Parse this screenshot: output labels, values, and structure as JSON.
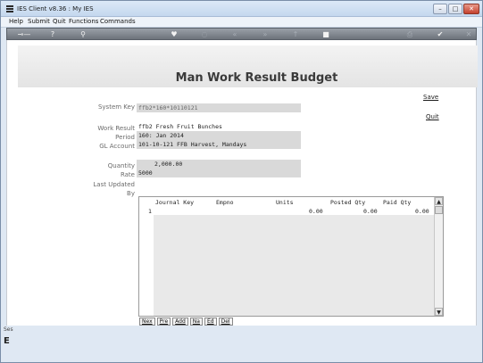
{
  "window": {
    "title": "IES Client v8.36 : My IES",
    "controls": {
      "minimize": "–",
      "maximize": "□",
      "close": "✕"
    }
  },
  "menu": {
    "items": [
      "Help",
      "Submit",
      "Quit",
      "Functions",
      "Commands"
    ]
  },
  "toolbar": {
    "icons": [
      "key-icon",
      "help-icon",
      "search-icon",
      "heart-icon",
      "refresh-icon",
      "rewind-icon",
      "forward-icon",
      "upload-icon",
      "stop-icon",
      "print-icon",
      "check-icon",
      "close-icon"
    ]
  },
  "page": {
    "title": "Man Work Result Budget",
    "save_label": "Save",
    "quit_label": "Quit"
  },
  "form": {
    "system_key_label": "System Key",
    "system_key_value": "ffb2*160*10110121",
    "work_result_label": "Work Result",
    "work_result_value": "ffb2  Fresh Fruit Bunches",
    "period_label": "Period",
    "period_value": "160: Jan 2014",
    "gl_account_label": "GL Account",
    "gl_account_value": "101-10-121 FFB Harvest, Mandays",
    "quantity_label": "Quantity",
    "quantity_value": "2,000.00",
    "rate_label": "Rate",
    "rate_value": "5000",
    "last_updated_label": "Last Updated",
    "by_label": "By"
  },
  "grid": {
    "columns": [
      "Journal Key",
      "Empno",
      "Units",
      "Posted Qty",
      "Paid Qty"
    ],
    "rows": [
      {
        "num": "1",
        "journal_key": "",
        "empno": "",
        "units": "0.00",
        "posted_qty": "0.00",
        "paid_qty": "0.00"
      }
    ],
    "buttons": [
      "Nex",
      "Pre",
      "Add",
      "Na",
      "Ed",
      "Del"
    ]
  },
  "status": {
    "text": "Ses",
    "glyph": "E"
  }
}
